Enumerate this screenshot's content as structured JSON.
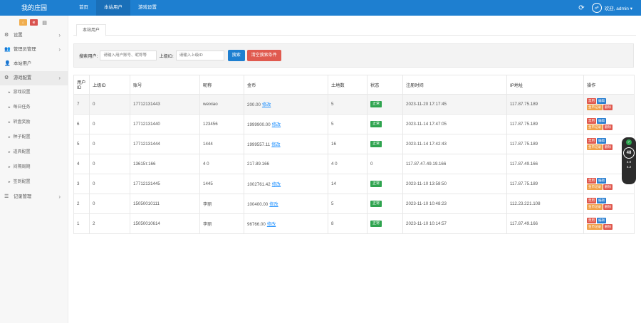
{
  "app": {
    "logo": "我的庄园",
    "nav": [
      "首页",
      "本站用户",
      "游戏设置"
    ],
    "user": "欢迎, admin ▾"
  },
  "sidebar": {
    "tools": [
      "⌂",
      "⊗",
      "▤"
    ],
    "items": [
      {
        "icon": "⚙",
        "label": "设置",
        "arrow": "›"
      },
      {
        "icon": "👥",
        "label": "管理员管理",
        "arrow": "›"
      },
      {
        "icon": "👤",
        "label": "本站用户",
        "arrow": ""
      },
      {
        "icon": "⚙",
        "label": "游戏配置",
        "arrow": "›"
      }
    ],
    "subitems": [
      "游戏设置",
      "每日任务",
      "转盘奖励",
      "种子配置",
      "道具配置",
      "间隔周期",
      "签到配置"
    ],
    "last": {
      "icon": "☰",
      "label": "记录管理",
      "arrow": "›"
    }
  },
  "tab": "本站用户",
  "search": {
    "label1": "搜索用户:",
    "placeholder1": "请输入用户账号、昵称等",
    "label2": "上级ID:",
    "placeholder2": "请输入上级ID",
    "btn_search": "搜索",
    "btn_clear": "清空搜索条件"
  },
  "table": {
    "headers": [
      "用户ID",
      "上级ID",
      "账号",
      "昵称",
      "金币",
      "土地数",
      "状态",
      "注册时间",
      "IP地址",
      "操作"
    ],
    "edit_link": "修改",
    "status_label": "正常",
    "ops": [
      "禁用",
      "编辑",
      "金币记录",
      "删除"
    ],
    "rows": [
      {
        "id": "7",
        "parent": "0",
        "account": "17712131443",
        "nick": "weixiao",
        "coins": "200.00",
        "land": "5",
        "time": "2023-11-20 17:17:45",
        "ip": "117.87.75.189"
      },
      {
        "id": "6",
        "parent": "0",
        "account": "17712131440",
        "nick": "123456",
        "coins": "1999900.00",
        "land": "5",
        "time": "2023-11-14 17:47:05",
        "ip": "117.87.75.189"
      },
      {
        "id": "5",
        "parent": "0",
        "account": "17712131444",
        "nick": "1444",
        "coins": "1999557.11",
        "land": "16",
        "time": "2023-11-14 17:42:43",
        "ip": "117.87.75.189"
      },
      {
        "id": "4",
        "parent": "0",
        "account": "13615т.166",
        "nick": "4 0",
        "coins": "217.89.166",
        "land": "4 0",
        "time": "117.87.47.49.19.166",
        "ip": "117.87.49.166",
        "glitch": true
      },
      {
        "id": "3",
        "parent": "0",
        "account": "17712131445",
        "nick": "1445",
        "coins": "1002761.42",
        "land": "14",
        "time": "2023-11-10 13:58:50",
        "ip": "117.87.75.189"
      },
      {
        "id": "2",
        "parent": "0",
        "account": "15050010111",
        "nick": "李丽",
        "coins": "100400.00",
        "land": "5",
        "time": "2023-11-10 10:48:23",
        "ip": "112.23.221.108"
      },
      {
        "id": "1",
        "parent": "2",
        "account": "15050010614",
        "nick": "李丽",
        "coins": "96766.00",
        "land": "8",
        "time": "2023-11-10 10:14:57",
        "ip": "117.87.49.166"
      }
    ]
  },
  "widget": {
    "value": "48",
    "up": "2.0",
    "down": "4.2"
  }
}
